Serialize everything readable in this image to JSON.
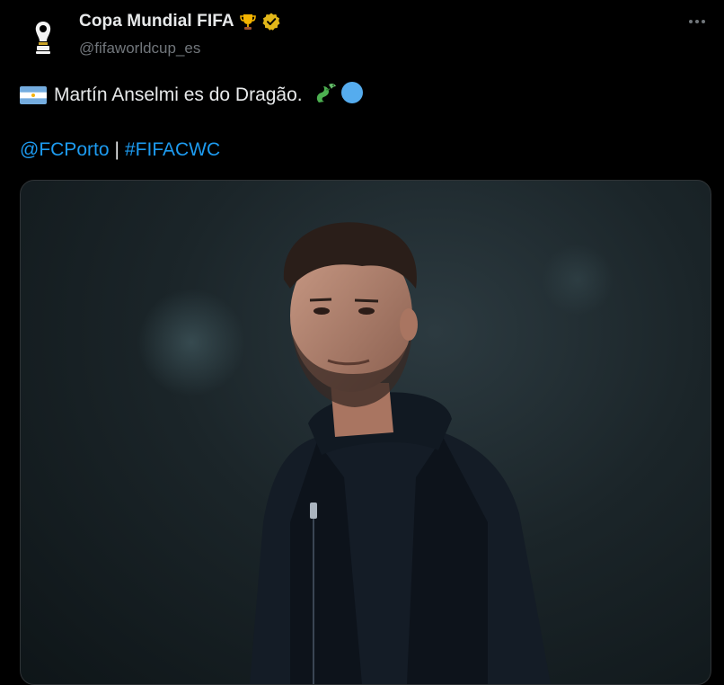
{
  "tweet": {
    "author": {
      "display_name": "Copa Mundial FIFA",
      "handle": "@fifaworldcup_es",
      "avatar_icon": "fifa-world-cup-logo-icon",
      "name_emoji": "trophy-icon",
      "verified": true,
      "verified_color": "#e2b719"
    },
    "more_icon": "more-dots-icon",
    "text": "Martín Anselmi es do Dragão.",
    "flag_icon": "argentina-flag-icon",
    "trailing_emojis": [
      "dragon-icon",
      "blue-circle-icon"
    ],
    "mentions": {
      "mention": "@FCPorto",
      "separator": "|",
      "hashtag": "#FIFACWC"
    },
    "media": {
      "type": "photo",
      "subject": "man-in-dark-jacket-photo"
    }
  },
  "colors": {
    "background": "#000000",
    "text": "#e7e9ea",
    "secondary": "#71767b",
    "link": "#1d9bf0"
  }
}
